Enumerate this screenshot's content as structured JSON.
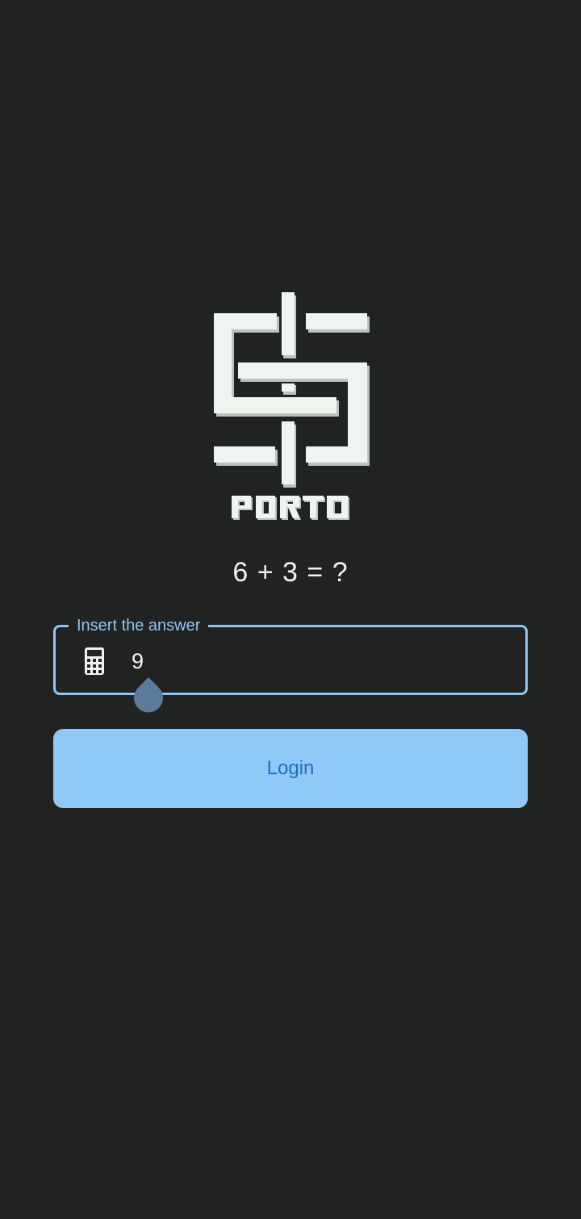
{
  "logo": {
    "wordmark": "PORTO",
    "color": "#eef5f0",
    "shadow": "#b8c4bc"
  },
  "captcha": {
    "question": "6 + 3 = ?"
  },
  "answer_field": {
    "label": "Insert the answer",
    "value": "9",
    "icon": "calculator-icon",
    "accent": "#8fc6f5"
  },
  "login": {
    "label": "Login",
    "background": "#90c8f6",
    "text_color": "#1f6fbf"
  }
}
